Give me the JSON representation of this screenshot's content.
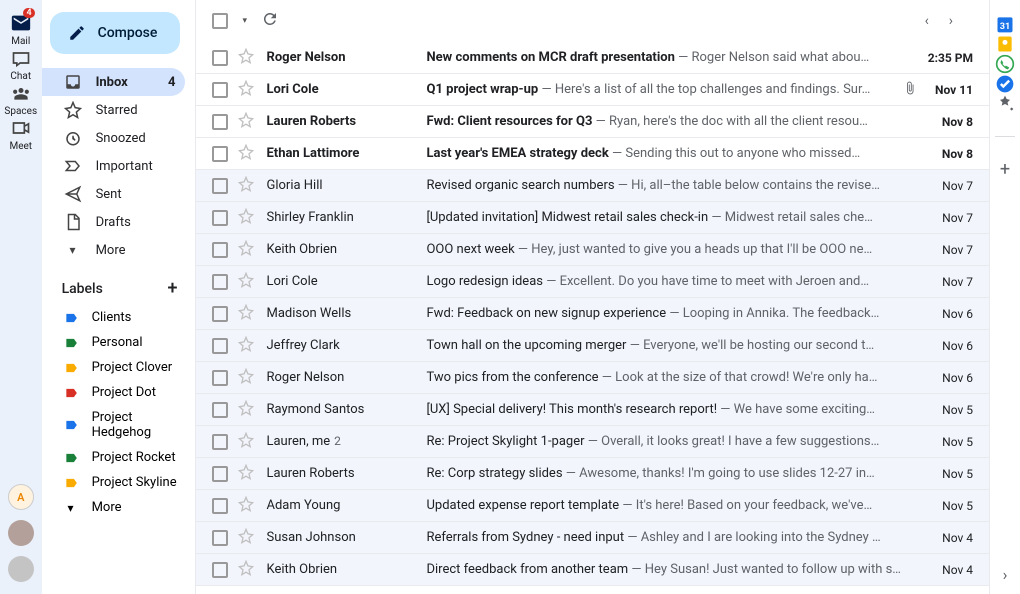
{
  "rail": {
    "items": [
      {
        "label": "Mail",
        "icon": "mail",
        "badge": "4"
      },
      {
        "label": "Chat",
        "icon": "chat"
      },
      {
        "label": "Spaces",
        "icon": "spaces"
      },
      {
        "label": "Meet",
        "icon": "meet"
      }
    ],
    "avatars": [
      {
        "initials": "A",
        "bg": "#fff3e0",
        "fg": "#ea8600",
        "ring": "#ccc"
      },
      {
        "initials": "",
        "bg": "#b4a09a",
        "fg": "#fff"
      },
      {
        "initials": "",
        "bg": "#c4c4c4",
        "fg": "#fff"
      }
    ]
  },
  "compose_label": "Compose",
  "nav": [
    {
      "label": "Inbox",
      "icon": "inbox",
      "active": true,
      "count": "4"
    },
    {
      "label": "Starred",
      "icon": "star"
    },
    {
      "label": "Snoozed",
      "icon": "snooze"
    },
    {
      "label": "Important",
      "icon": "important"
    },
    {
      "label": "Sent",
      "icon": "sent"
    },
    {
      "label": "Drafts",
      "icon": "drafts"
    },
    {
      "label": "More",
      "icon": "more"
    }
  ],
  "labels_header": "Labels",
  "labels": [
    {
      "label": "Clients",
      "color": "#1a73e8"
    },
    {
      "label": "Personal",
      "color": "#188038"
    },
    {
      "label": "Project Clover",
      "color": "#f9ab00"
    },
    {
      "label": "Project Dot",
      "color": "#d93025"
    },
    {
      "label": "Project Hedgehog",
      "color": "#1a73e8"
    },
    {
      "label": "Project Rocket",
      "color": "#188038"
    },
    {
      "label": "Project Skyline",
      "color": "#f9ab00"
    },
    {
      "label": "More",
      "color": null
    }
  ],
  "messages": [
    {
      "unread": true,
      "sender": "Roger Nelson",
      "subject": "New comments on MCR draft presentation",
      "snippet": " — Roger Nelson said what abou…",
      "date": "2:35 PM"
    },
    {
      "unread": true,
      "sender": "Lori Cole",
      "subject": "Q1 project wrap-up",
      "snippet": " — Here's a list of all the top challenges and findings. Sur…",
      "date": "Nov 11",
      "attach": true
    },
    {
      "unread": true,
      "sender": "Lauren Roberts",
      "subject": "Fwd: Client resources for Q3",
      "snippet": " — Ryan, here's the doc with all the client resou…",
      "date": "Nov 8"
    },
    {
      "unread": true,
      "sender": "Ethan Lattimore",
      "subject": "Last year's EMEA strategy deck",
      "snippet": " — Sending this out to anyone who missed…",
      "date": "Nov 8"
    },
    {
      "unread": false,
      "sender": "Gloria Hill",
      "subject": "Revised organic search numbers",
      "snippet": " — Hi, all–the table below contains the revise…",
      "date": "Nov 7"
    },
    {
      "unread": false,
      "sender": "Shirley Franklin",
      "subject": "[Updated invitation] Midwest retail sales check-in",
      "snippet": " — Midwest retail sales che…",
      "date": "Nov 7"
    },
    {
      "unread": false,
      "sender": "Keith Obrien",
      "subject": "OOO next week",
      "snippet": " — Hey, just wanted to give you a heads up that I'll be OOO ne…",
      "date": "Nov 7"
    },
    {
      "unread": false,
      "sender": "Lori Cole",
      "subject": "Logo redesign ideas",
      "snippet": " — Excellent. Do you have time to meet with Jeroen and…",
      "date": "Nov 7"
    },
    {
      "unread": false,
      "sender": "Madison Wells",
      "subject": "Fwd: Feedback on new signup experience",
      "snippet": " — Looping in Annika. The feedback…",
      "date": "Nov 6"
    },
    {
      "unread": false,
      "sender": "Jeffrey Clark",
      "subject": "Town hall on the upcoming merger",
      "snippet": " — Everyone, we'll be hosting our second t…",
      "date": "Nov 6"
    },
    {
      "unread": false,
      "sender": "Roger Nelson",
      "subject": "Two pics from the conference",
      "snippet": " — Look at the size of that crowd! We're only ha…",
      "date": "Nov 6"
    },
    {
      "unread": false,
      "sender": "Raymond Santos",
      "subject": "[UX] Special delivery! This month's research report!",
      "snippet": " — We have some exciting…",
      "date": "Nov 5"
    },
    {
      "unread": false,
      "sender": "Lauren, me",
      "count": "2",
      "subject": "Re: Project Skylight 1-pager",
      "snippet": " — Overall, it looks great! I have a few suggestions…",
      "date": "Nov 5"
    },
    {
      "unread": false,
      "sender": "Lauren Roberts",
      "subject": "Re: Corp strategy slides",
      "snippet": " — Awesome, thanks! I'm going to use slides 12-27 in…",
      "date": "Nov 5"
    },
    {
      "unread": false,
      "sender": "Adam Young",
      "subject": "Updated expense report template",
      "snippet": " — It's here! Based on your feedback, we've…",
      "date": "Nov 5"
    },
    {
      "unread": false,
      "sender": "Susan Johnson",
      "subject": "Referrals from Sydney - need input",
      "snippet": " — Ashley and I are looking into the Sydney …",
      "date": "Nov 4"
    },
    {
      "unread": false,
      "sender": "Keith Obrien",
      "subject": "Direct feedback from another team",
      "snippet": " — Hey Susan! Just wanted to follow up with s…",
      "date": "Nov 4"
    }
  ],
  "sidepanel": [
    {
      "name": "calendar-icon",
      "color": "#1a73e8"
    },
    {
      "name": "keep-icon",
      "color": "#fbbc04"
    },
    {
      "name": "contacts-icon",
      "color": "#34a853",
      "phone": true
    },
    {
      "name": "tasks-icon",
      "color": "#1a73e8",
      "check": true
    },
    {
      "name": "addon-icon"
    }
  ]
}
